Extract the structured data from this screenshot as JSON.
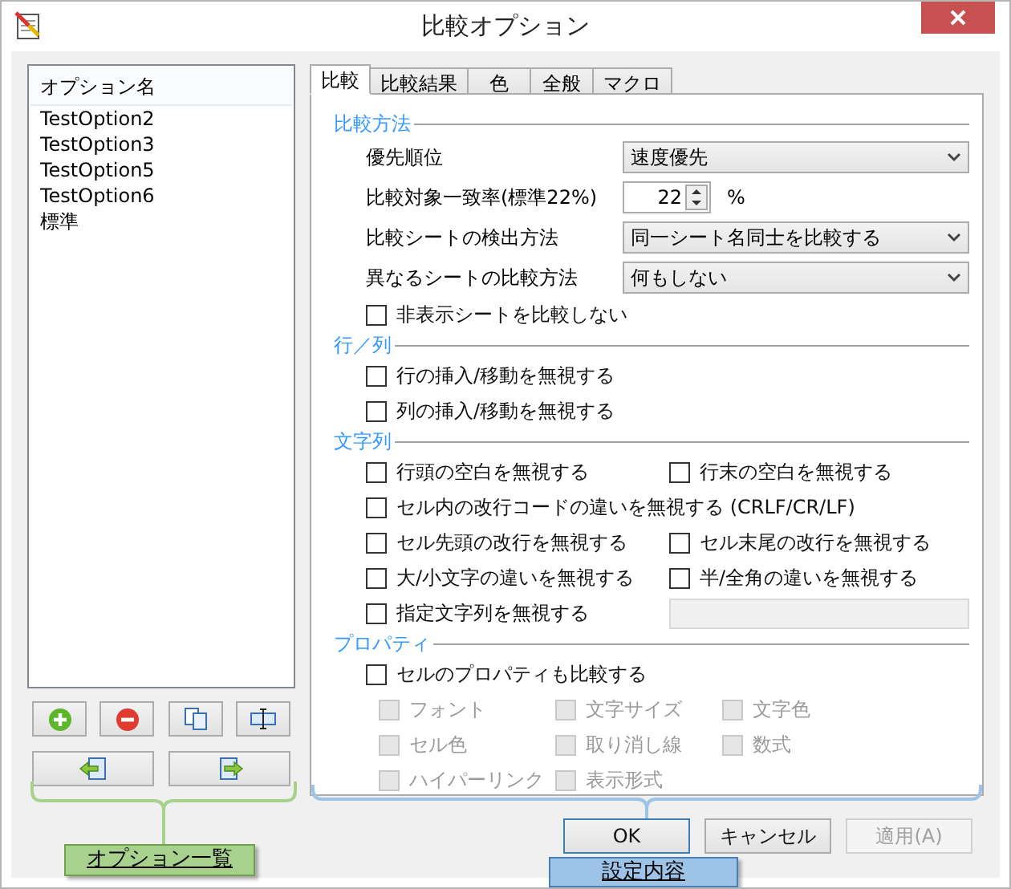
{
  "window": {
    "title": "比較オプション"
  },
  "option_list": {
    "header": "オプション名",
    "items": [
      {
        "label": "TestOption2"
      },
      {
        "label": "TestOption3"
      },
      {
        "label": "TestOption5"
      },
      {
        "label": "TestOption6"
      },
      {
        "label": "標準"
      }
    ]
  },
  "tabs": [
    {
      "label": "比較",
      "selected": true
    },
    {
      "label": "比較結果",
      "selected": false
    },
    {
      "label": "色",
      "selected": false
    },
    {
      "label": "全般",
      "selected": false
    },
    {
      "label": "マクロ",
      "selected": false
    }
  ],
  "sections": [
    {
      "title": "比較方法",
      "rows": [
        {
          "kind": "select",
          "label": "優先順位",
          "value": "速度優先"
        },
        {
          "kind": "spin",
          "label": "比較対象一致率(標準22%)",
          "value": "22",
          "unit": "%"
        },
        {
          "kind": "select",
          "label": "比較シートの検出方法",
          "value": "同一シート名同士を比較する"
        },
        {
          "kind": "select",
          "label": "異なるシートの比較方法",
          "value": "何もしない"
        },
        {
          "kind": "checks",
          "items": [
            {
              "label": "非表示シートを比較しない",
              "checked": false
            }
          ]
        }
      ]
    },
    {
      "title": "行／列",
      "rows": [
        {
          "kind": "checks",
          "items": [
            {
              "label": "行の挿入/移動を無視する",
              "checked": false
            }
          ]
        },
        {
          "kind": "checks",
          "items": [
            {
              "label": "列の挿入/移動を無視する",
              "checked": false
            }
          ]
        }
      ]
    },
    {
      "title": "文字列",
      "rows": [
        {
          "kind": "checks",
          "items": [
            {
              "label": "行頭の空白を無視する",
              "checked": false
            },
            {
              "label": "行末の空白を無視する",
              "checked": false
            }
          ]
        },
        {
          "kind": "checks",
          "items": [
            {
              "label": "セル内の改行コードの違いを無視する (CRLF/CR/LF)",
              "checked": false
            }
          ]
        },
        {
          "kind": "checks",
          "items": [
            {
              "label": "セル先頭の改行を無視する",
              "checked": false
            },
            {
              "label": "セル末尾の改行を無視する",
              "checked": false
            }
          ]
        },
        {
          "kind": "checks",
          "items": [
            {
              "label": "大/小文字の違いを無視する",
              "checked": false
            },
            {
              "label": "半/全角の違いを無視する",
              "checked": false
            }
          ]
        },
        {
          "kind": "check_field",
          "label": "指定文字列を無視する",
          "checked": false,
          "field_disabled": true
        }
      ]
    },
    {
      "title": "プロパティ",
      "rows": [
        {
          "kind": "checks",
          "items": [
            {
              "label": "セルのプロパティも比較する",
              "checked": false
            }
          ]
        },
        {
          "kind": "grid",
          "items": [
            {
              "label": "フォント",
              "checked": false,
              "disabled": true
            },
            {
              "label": "文字サイズ",
              "checked": false,
              "disabled": true
            },
            {
              "label": "文字色",
              "checked": false,
              "disabled": true
            },
            {
              "label": "セル色",
              "checked": false,
              "disabled": true
            },
            {
              "label": "取り消し線",
              "checked": false,
              "disabled": true
            },
            {
              "label": "数式",
              "checked": false,
              "disabled": true
            },
            {
              "label": "ハイパーリンク",
              "checked": false,
              "disabled": true
            },
            {
              "label": "表示形式",
              "checked": false,
              "disabled": true
            }
          ]
        }
      ]
    }
  ],
  "buttons": [
    {
      "label": "OK",
      "disabled": false,
      "default": true
    },
    {
      "label": "キャンセル",
      "disabled": false,
      "default": false
    },
    {
      "label": "適用(A)",
      "disabled": true,
      "default": false
    }
  ],
  "annotations": [
    {
      "label": "オプション一覧",
      "color": "#a9d18e"
    },
    {
      "label": "設定内容",
      "color": "#9dc3e6"
    }
  ]
}
